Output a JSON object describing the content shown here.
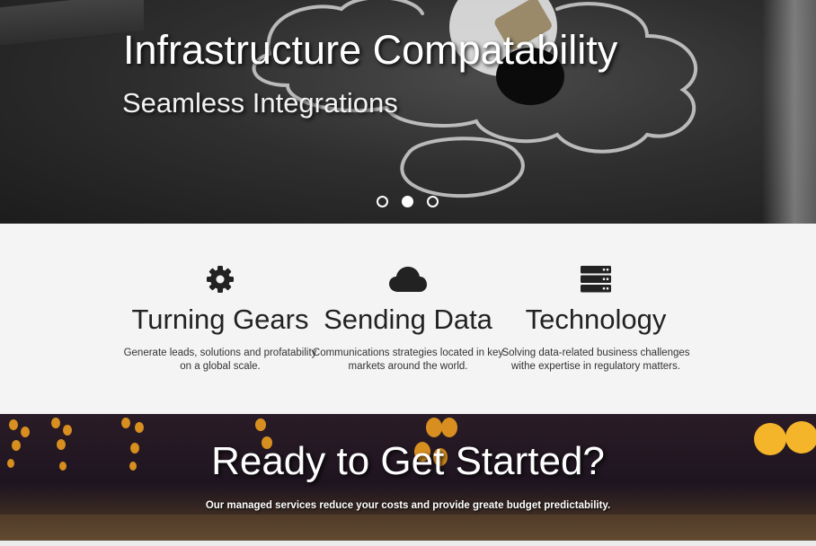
{
  "hero": {
    "title": "Infrastructure Compatability",
    "subtitle": "Seamless Integrations",
    "carousel": {
      "slides": 3,
      "active_index": 1
    }
  },
  "features": [
    {
      "icon": "gear-icon",
      "title": "Turning Gears",
      "text": "Generate leads, solutions and profatability on a global scale."
    },
    {
      "icon": "cloud-icon",
      "title": "Sending Data",
      "text": "Communications strategies located in key markets around the world."
    },
    {
      "icon": "server-icon",
      "title": "Technology",
      "text": "Solving data-related business challenges withe expertise in regulatory matters."
    }
  ],
  "cta": {
    "title": "Ready to Get Started?",
    "text": "Our managed services reduce your costs and provide greate budget predictability."
  },
  "colors": {
    "icon": "#222222",
    "hero_text": "#ffffff",
    "cta_glow": "#f5a623"
  }
}
